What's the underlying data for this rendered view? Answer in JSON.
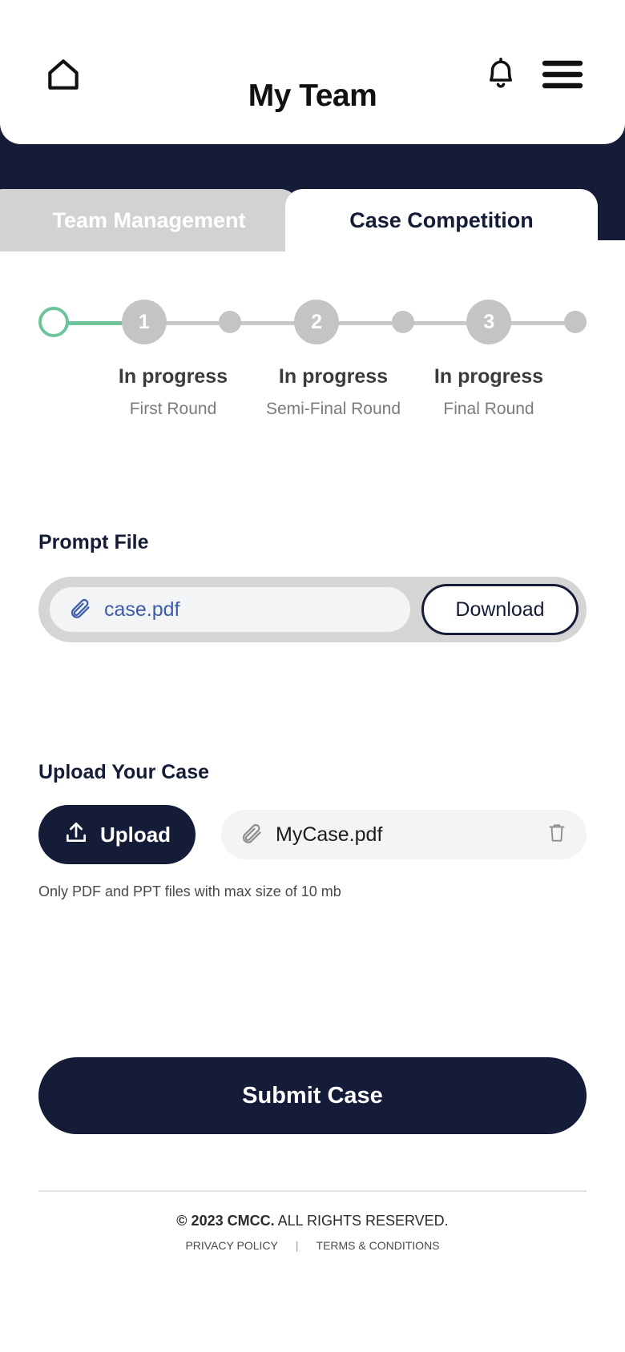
{
  "theme": {
    "navy": "#141c38",
    "green": "#6dc49a",
    "gray_node": "#c4c4c4",
    "link_blue": "#3c5ba8",
    "tab_inactive": "#d2d2d2"
  },
  "header": {
    "title": "My Team",
    "home_icon": "home-icon",
    "bell_icon": "bell-icon",
    "menu_icon": "hamburger-menu-icon"
  },
  "tabs": [
    {
      "label": "Team Management",
      "active": false
    },
    {
      "label": "Case Competition",
      "active": true
    }
  ],
  "stepper": {
    "start_marker": "start-circle",
    "steps": [
      {
        "number": "1",
        "status": "In progress",
        "round": "First Round"
      },
      {
        "number": "2",
        "status": "In progress",
        "round": "Semi-Final Round"
      },
      {
        "number": "3",
        "status": "In progress",
        "round": "Final Round"
      }
    ]
  },
  "prompt_file": {
    "title": "Prompt File",
    "file_name": "case.pdf",
    "attachment_icon": "paperclip-icon",
    "download_label": "Download"
  },
  "upload": {
    "title": "Upload Your Case",
    "button_label": "Upload",
    "upload_icon": "upload-arrow-icon",
    "attachment_icon": "paperclip-icon",
    "file_name": "MyCase.pdf",
    "delete_icon": "trash-icon",
    "hint": "Only PDF and PPT files with max size of 10 mb"
  },
  "submit": {
    "label": "Submit Case"
  },
  "footer": {
    "copyright_bold": "© 2023 CMCC.",
    "copyright_rest": " ALL RIGHTS RESERVED.",
    "privacy_label": "PRIVACY POLICY",
    "separator": "|",
    "terms_label": "TERMS & CONDITIONS"
  }
}
